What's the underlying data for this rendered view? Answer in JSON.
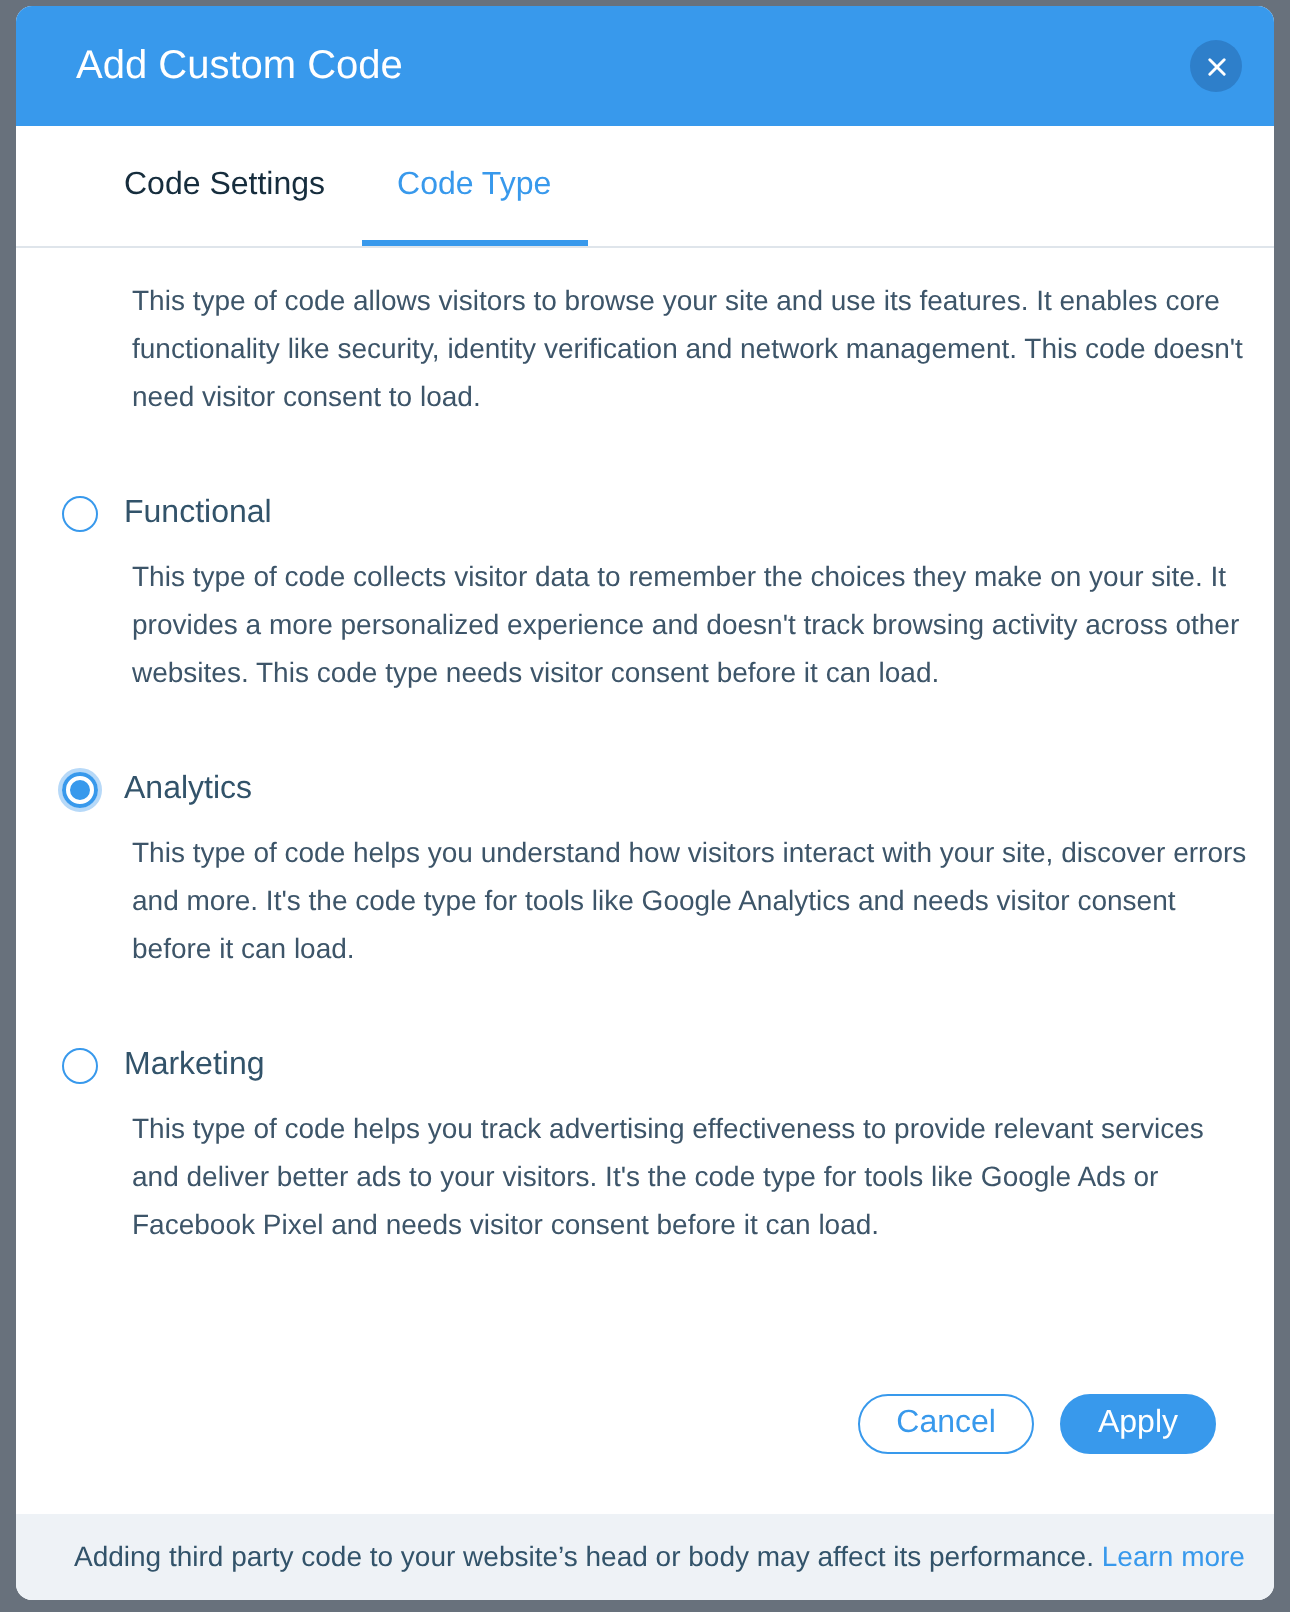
{
  "dialog": {
    "title": "Add Custom Code"
  },
  "tabs": [
    {
      "label": "Code Settings",
      "selected": false
    },
    {
      "label": "Code Type",
      "selected": true
    }
  ],
  "scrolled_description": "This type of code allows visitors to browse your site and use its features. It enables core functionality like security, identity verification and network management. This code doesn't need visitor consent to load.",
  "options": [
    {
      "label": "Functional",
      "selected": false,
      "description": "This type of code collects visitor data to remember the choices they make on your site. It provides a more personalized experience and doesn't track browsing activity across other websites. This code type needs visitor consent before it can load."
    },
    {
      "label": "Analytics",
      "selected": true,
      "description": "This type of code helps you understand how visitors interact with your site, discover errors and more. It's the code type for tools like Google Analytics and needs visitor consent before it can load."
    },
    {
      "label": "Marketing",
      "selected": false,
      "description": "This type of code helps you track advertising effectiveness to provide relevant services and deliver better ads to your visitors. It's the code type for tools like Google Ads or Facebook Pixel and needs visitor consent before it can load."
    }
  ],
  "buttons": [
    {
      "label": "Cancel",
      "kind": "secondary"
    },
    {
      "label": "Apply",
      "kind": "primary"
    }
  ],
  "footer": {
    "text": "Adding third party code to your website’s head or body may affect its performance.",
    "link": "Learn more"
  }
}
